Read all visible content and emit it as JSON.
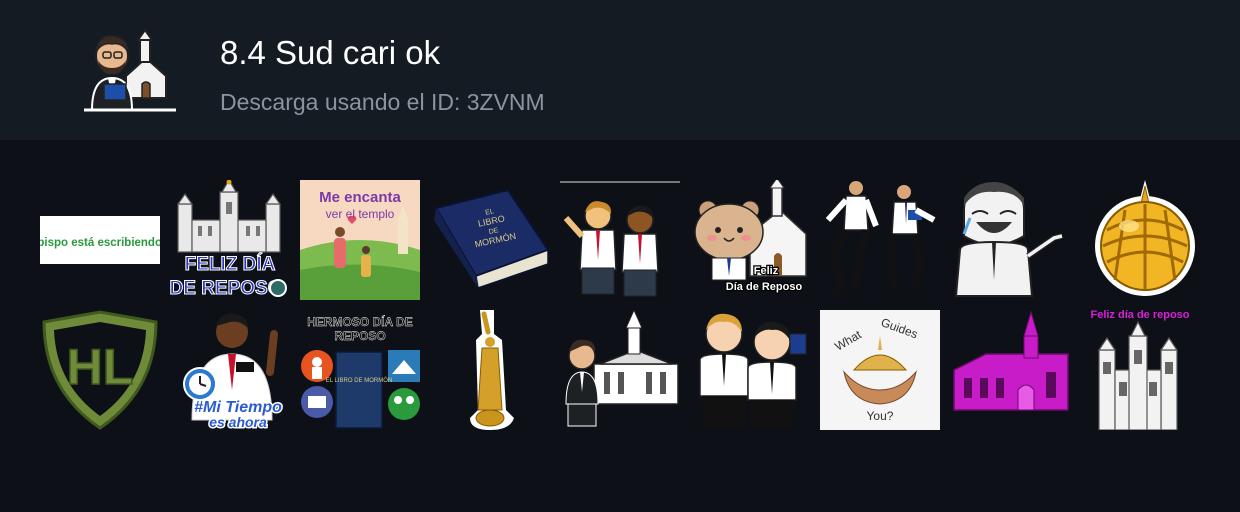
{
  "pack": {
    "title": "8.4 Sud cari ok",
    "subtitle": "Descarga usando el ID: 3ZVNM"
  },
  "stickers": {
    "s1": "Obispo está escribiendo...",
    "s2_l1": "FELIZ DÍA",
    "s2_l2": "DE REPOSO",
    "s3_l1": "Me encanta",
    "s3_l2": "ver el templo",
    "s4_l1": "EL",
    "s4_l2": "LIBRO",
    "s4_l3": "DE",
    "s4_l4": "MORMÓN",
    "s6_l1": "Feliz",
    "s6_l2": "Día de Reposo",
    "s10_l1": "HL",
    "s11_l1": "#Mi Tiempo",
    "s11_l2": "es ahora",
    "s12_l1": "HERMOSO DÍA DE",
    "s12_l2": "REPOSO",
    "s12_book": "EL LIBRO DE MORMÓN",
    "s16_l1": "What",
    "s16_l2": "Guides",
    "s16_l3": "You?",
    "s18_l1": "Feliz día de reposo"
  },
  "colors": {
    "header_bg": "#151b23",
    "page_bg": "#0d1117",
    "title": "#ffffff",
    "subtitle": "#8b949e",
    "feliz_blue": "#1f2a9c",
    "magenta": "#d91fd9",
    "gold": "#e5a317",
    "hl_green": "#6f8b3a"
  }
}
